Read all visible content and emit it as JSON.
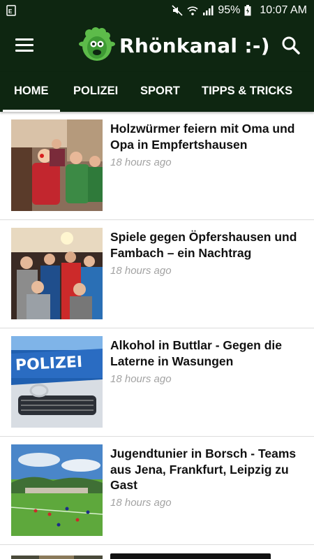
{
  "status": {
    "battery": "95%",
    "time": "10:07 AM"
  },
  "app": {
    "title": "Rhönkanal :-)"
  },
  "tabs": [
    {
      "label": "HOME",
      "active": true
    },
    {
      "label": "POLIZEI",
      "active": false
    },
    {
      "label": "SPORT",
      "active": false
    },
    {
      "label": "TIPPS & TRICKS",
      "active": false
    }
  ],
  "articles": [
    {
      "title": "Holzwürmer feiern mit Oma und Opa in Empfertshausen",
      "time": "18 hours ago",
      "image": "carnival-children-photo"
    },
    {
      "title": "Spiele gegen Öpfershausen und Fambach – ein Nachtrag",
      "time": "18 hours ago",
      "image": "team-celebration-photo"
    },
    {
      "title": "Alkohol in Buttlar - Gegen die Laterne in Wasungen",
      "time": "18 hours ago",
      "image": "police-car-photo"
    },
    {
      "title": "Jugendtunier in Borsch - Teams aus Jena, Frankfurt, Leipzig zu Gast",
      "time": "18 hours ago",
      "image": "football-field-photo"
    }
  ],
  "colors": {
    "header": "#0e2611",
    "time_text": "#a3a3a3"
  }
}
